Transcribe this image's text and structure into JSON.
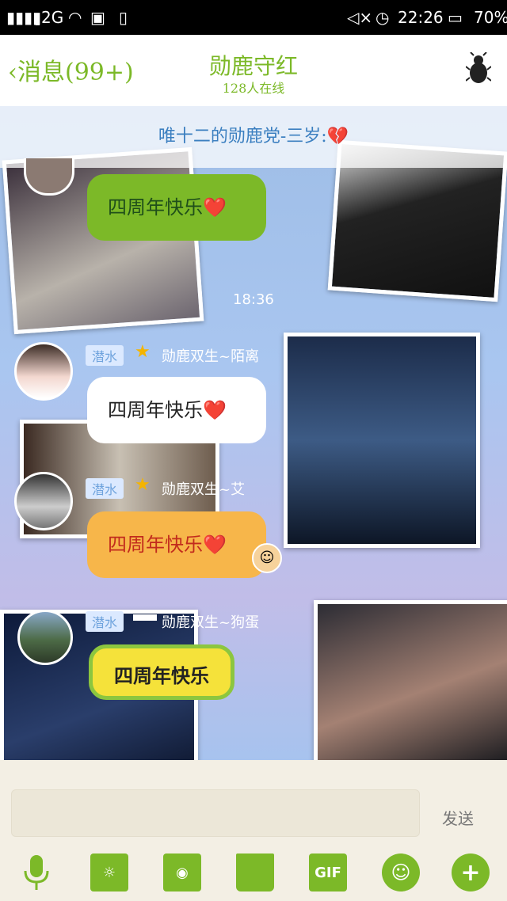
{
  "status_bar": {
    "signal": "2",
    "network": "2G",
    "time": "22:26",
    "battery": "70%"
  },
  "header": {
    "back_label": "消息(99+)",
    "title": "勋鹿守红",
    "subtitle": "128人在线",
    "menu_icon": "beetle-icon"
  },
  "announcement": "唯十二的勋鹿党-三岁:💔",
  "messages": [
    {
      "text": "四周年快乐❤️"
    },
    {
      "time": "18:36"
    },
    {
      "tag": "潜水",
      "nick": "勋鹿双生~陌离",
      "text": "四周年快乐❤️"
    },
    {
      "tag": "潜水",
      "nick": "勋鹿双生~艾",
      "text": "四周年快乐❤️"
    },
    {
      "tag": "潜水",
      "nick": "勋鹿双生~狗蛋",
      "text": "四周年快乐"
    }
  ],
  "composer": {
    "input_value": "",
    "send_label": "发送"
  },
  "toolbar": {
    "gif_label": "GIF"
  },
  "colors": {
    "accent_green": "#7cb928",
    "bubble_green": "#7cb928",
    "bubble_orange": "#f7b64a",
    "bubble_yellow": "#f5e23a"
  }
}
